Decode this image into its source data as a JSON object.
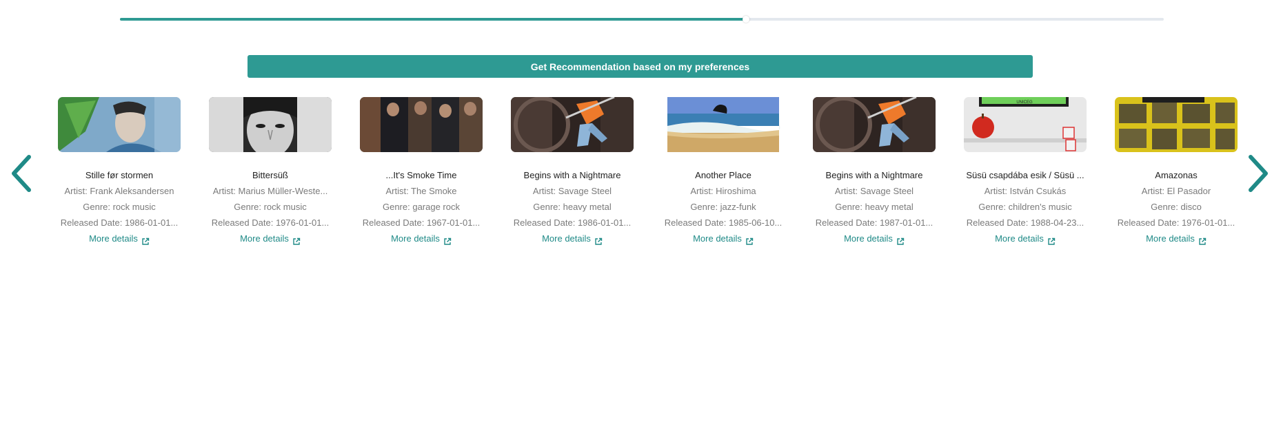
{
  "slider": {
    "value_fraction": 0.6
  },
  "recommend_button": {
    "label": "Get Recommendation based on my preferences"
  },
  "carousel": {
    "prev_icon": "chevron-left-icon",
    "next_icon": "chevron-right-icon",
    "more_label": "More details",
    "link_icon": "external-link-icon",
    "items": [
      {
        "title": "Stille før stormen",
        "artist": "Artist: Frank Aleksandersen",
        "genre": "Genre: rock music",
        "released": "Released Date: 1986-01-01...",
        "cover": "green-blue portrait"
      },
      {
        "title": "Bittersüß",
        "artist": "Artist: Marius Müller-Weste...",
        "genre": "Genre: rock music",
        "released": "Released Date: 1976-01-01...",
        "cover": "black-and-white face"
      },
      {
        "title": "...It's Smoke Time",
        "artist": "Artist: The Smoke",
        "genre": "Genre: garage rock",
        "released": "Released Date: 1967-01-01...",
        "cover": "band photo"
      },
      {
        "title": "Begins with a Nightmare",
        "artist": "Artist: Savage Steel",
        "genre": "Genre: heavy metal",
        "released": "Released Date: 1986-01-01...",
        "cover": "warrior illustration"
      },
      {
        "title": "Another Place",
        "artist": "Artist: Hiroshima",
        "genre": "Genre: jazz-funk",
        "released": "Released Date: 1985-06-10...",
        "cover": "beach"
      },
      {
        "title": "Begins with a Nightmare",
        "artist": "Artist: Savage Steel",
        "genre": "Genre: heavy metal",
        "released": "Released Date: 1987-01-01...",
        "cover": "warrior illustration"
      },
      {
        "title": "Süsü csapdába esik / Süsü ...",
        "artist": "Artist: István Csukás",
        "genre": "Genre: children's music",
        "released": "Released Date: 1988-04-23...",
        "cover": "apple and blocks"
      },
      {
        "title": "Amazonas",
        "artist": "Artist: El Pasador",
        "genre": "Genre: disco",
        "released": "Released Date: 1976-01-01...",
        "cover": "yellow collage"
      }
    ]
  },
  "cover_logo_text": "UNICEG"
}
